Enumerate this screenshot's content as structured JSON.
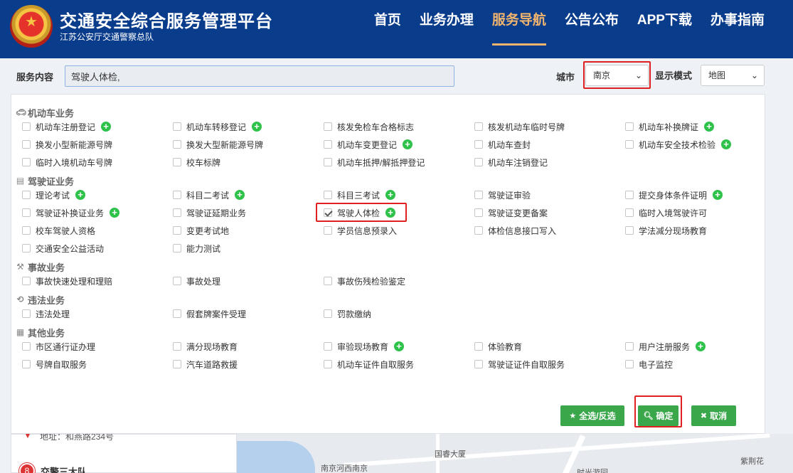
{
  "header": {
    "title": "交通安全综合服务管理平台",
    "subtitle": "江苏公安厅交通警察总队",
    "nav": [
      "首页",
      "业务办理",
      "服务导航",
      "公告公布",
      "APP下载",
      "办事指南"
    ],
    "active_nav": "服务导航"
  },
  "search": {
    "label": "服务内容",
    "value": "驾驶人体检,",
    "city_label": "城市",
    "city_value": "南京",
    "mode_label": "显示模式",
    "mode_value": "地图"
  },
  "sections": [
    {
      "title": "机动车业务",
      "icon": "car-icon",
      "items": [
        {
          "label": "机动车注册登记",
          "plus": true
        },
        {
          "label": "机动车转移登记",
          "plus": true
        },
        {
          "label": "核发免检车合格标志",
          "plus": false
        },
        {
          "label": "核发机动车临时号牌",
          "plus": false
        },
        {
          "label": "机动车补换牌证",
          "plus": true
        },
        {
          "label": "换发小型新能源号牌",
          "plus": false
        },
        {
          "label": "换发大型新能源号牌",
          "plus": false
        },
        {
          "label": "机动车变更登记",
          "plus": true
        },
        {
          "label": "机动车查封",
          "plus": false
        },
        {
          "label": "机动车安全技术检验",
          "plus": true
        },
        {
          "label": "临时入境机动车号牌",
          "plus": false
        },
        {
          "label": "校车标牌",
          "plus": false
        },
        {
          "label": "机动车抵押/解抵押登记",
          "plus": false
        },
        {
          "label": "机动车注销登记",
          "plus": false
        }
      ]
    },
    {
      "title": "驾驶证业务",
      "icon": "id-card-icon",
      "items": [
        {
          "label": "理论考试",
          "plus": true
        },
        {
          "label": "科目二考试",
          "plus": true
        },
        {
          "label": "科目三考试",
          "plus": true
        },
        {
          "label": "驾驶证审验",
          "plus": false
        },
        {
          "label": "提交身体条件证明",
          "plus": true
        },
        {
          "label": "驾驶证补换证业务",
          "plus": true
        },
        {
          "label": "驾驶证延期业务",
          "plus": false
        },
        {
          "label": "驾驶人体检",
          "plus": true,
          "checked": true
        },
        {
          "label": "驾驶证变更备案",
          "plus": false
        },
        {
          "label": "临时入境驾驶许可",
          "plus": false
        },
        {
          "label": "校车驾驶人资格",
          "plus": false
        },
        {
          "label": "变更考试地",
          "plus": false
        },
        {
          "label": "学员信息预录入",
          "plus": false
        },
        {
          "label": "体检信息接口写入",
          "plus": false
        },
        {
          "label": "学法减分现场教育",
          "plus": false
        },
        {
          "label": "交通安全公益活动",
          "plus": false
        },
        {
          "label": "能力测试",
          "plus": false
        }
      ]
    },
    {
      "title": "事故业务",
      "icon": "gavel-icon",
      "items": [
        {
          "label": "事故快速处理和理赔",
          "plus": false
        },
        {
          "label": "事故处理",
          "plus": false
        },
        {
          "label": "事故伤残检验鉴定",
          "plus": false
        }
      ]
    },
    {
      "title": "违法业务",
      "icon": "history-icon",
      "items": [
        {
          "label": "违法处理",
          "plus": false
        },
        {
          "label": "假套牌案件受理",
          "plus": false
        },
        {
          "label": "罚款缴纳",
          "plus": false
        }
      ]
    },
    {
      "title": "其他业务",
      "icon": "grid-icon",
      "items": [
        {
          "label": "市区通行证办理",
          "plus": false
        },
        {
          "label": "满分现场教育",
          "plus": false
        },
        {
          "label": "审验现场教育",
          "plus": true
        },
        {
          "label": "体验教育",
          "plus": false
        },
        {
          "label": "用户注册服务",
          "plus": true
        },
        {
          "label": "号牌自取服务",
          "plus": false
        },
        {
          "label": "汽车道路救援",
          "plus": false
        },
        {
          "label": "机动车证件自取服务",
          "plus": false
        },
        {
          "label": "驾驶证证件自取服务",
          "plus": false
        },
        {
          "label": "电子监控",
          "plus": false
        }
      ]
    }
  ],
  "buttons": {
    "select_all": "全选/反选",
    "confirm": "确定",
    "cancel": "取消"
  },
  "background": {
    "address_label": "地址：",
    "address_value": "和燕路234号",
    "team_number": "8",
    "team_name": "交警三大队",
    "map_labels": [
      "国睿大厦",
      "南京河西南京",
      "紫荆花",
      "时光游园"
    ]
  },
  "colors": {
    "header_bg": "#0a3c8c",
    "nav_active": "#f0b46e",
    "button_green": "#3aa74a",
    "plus_green": "#2fc24a",
    "highlight_red": "#e02020"
  }
}
